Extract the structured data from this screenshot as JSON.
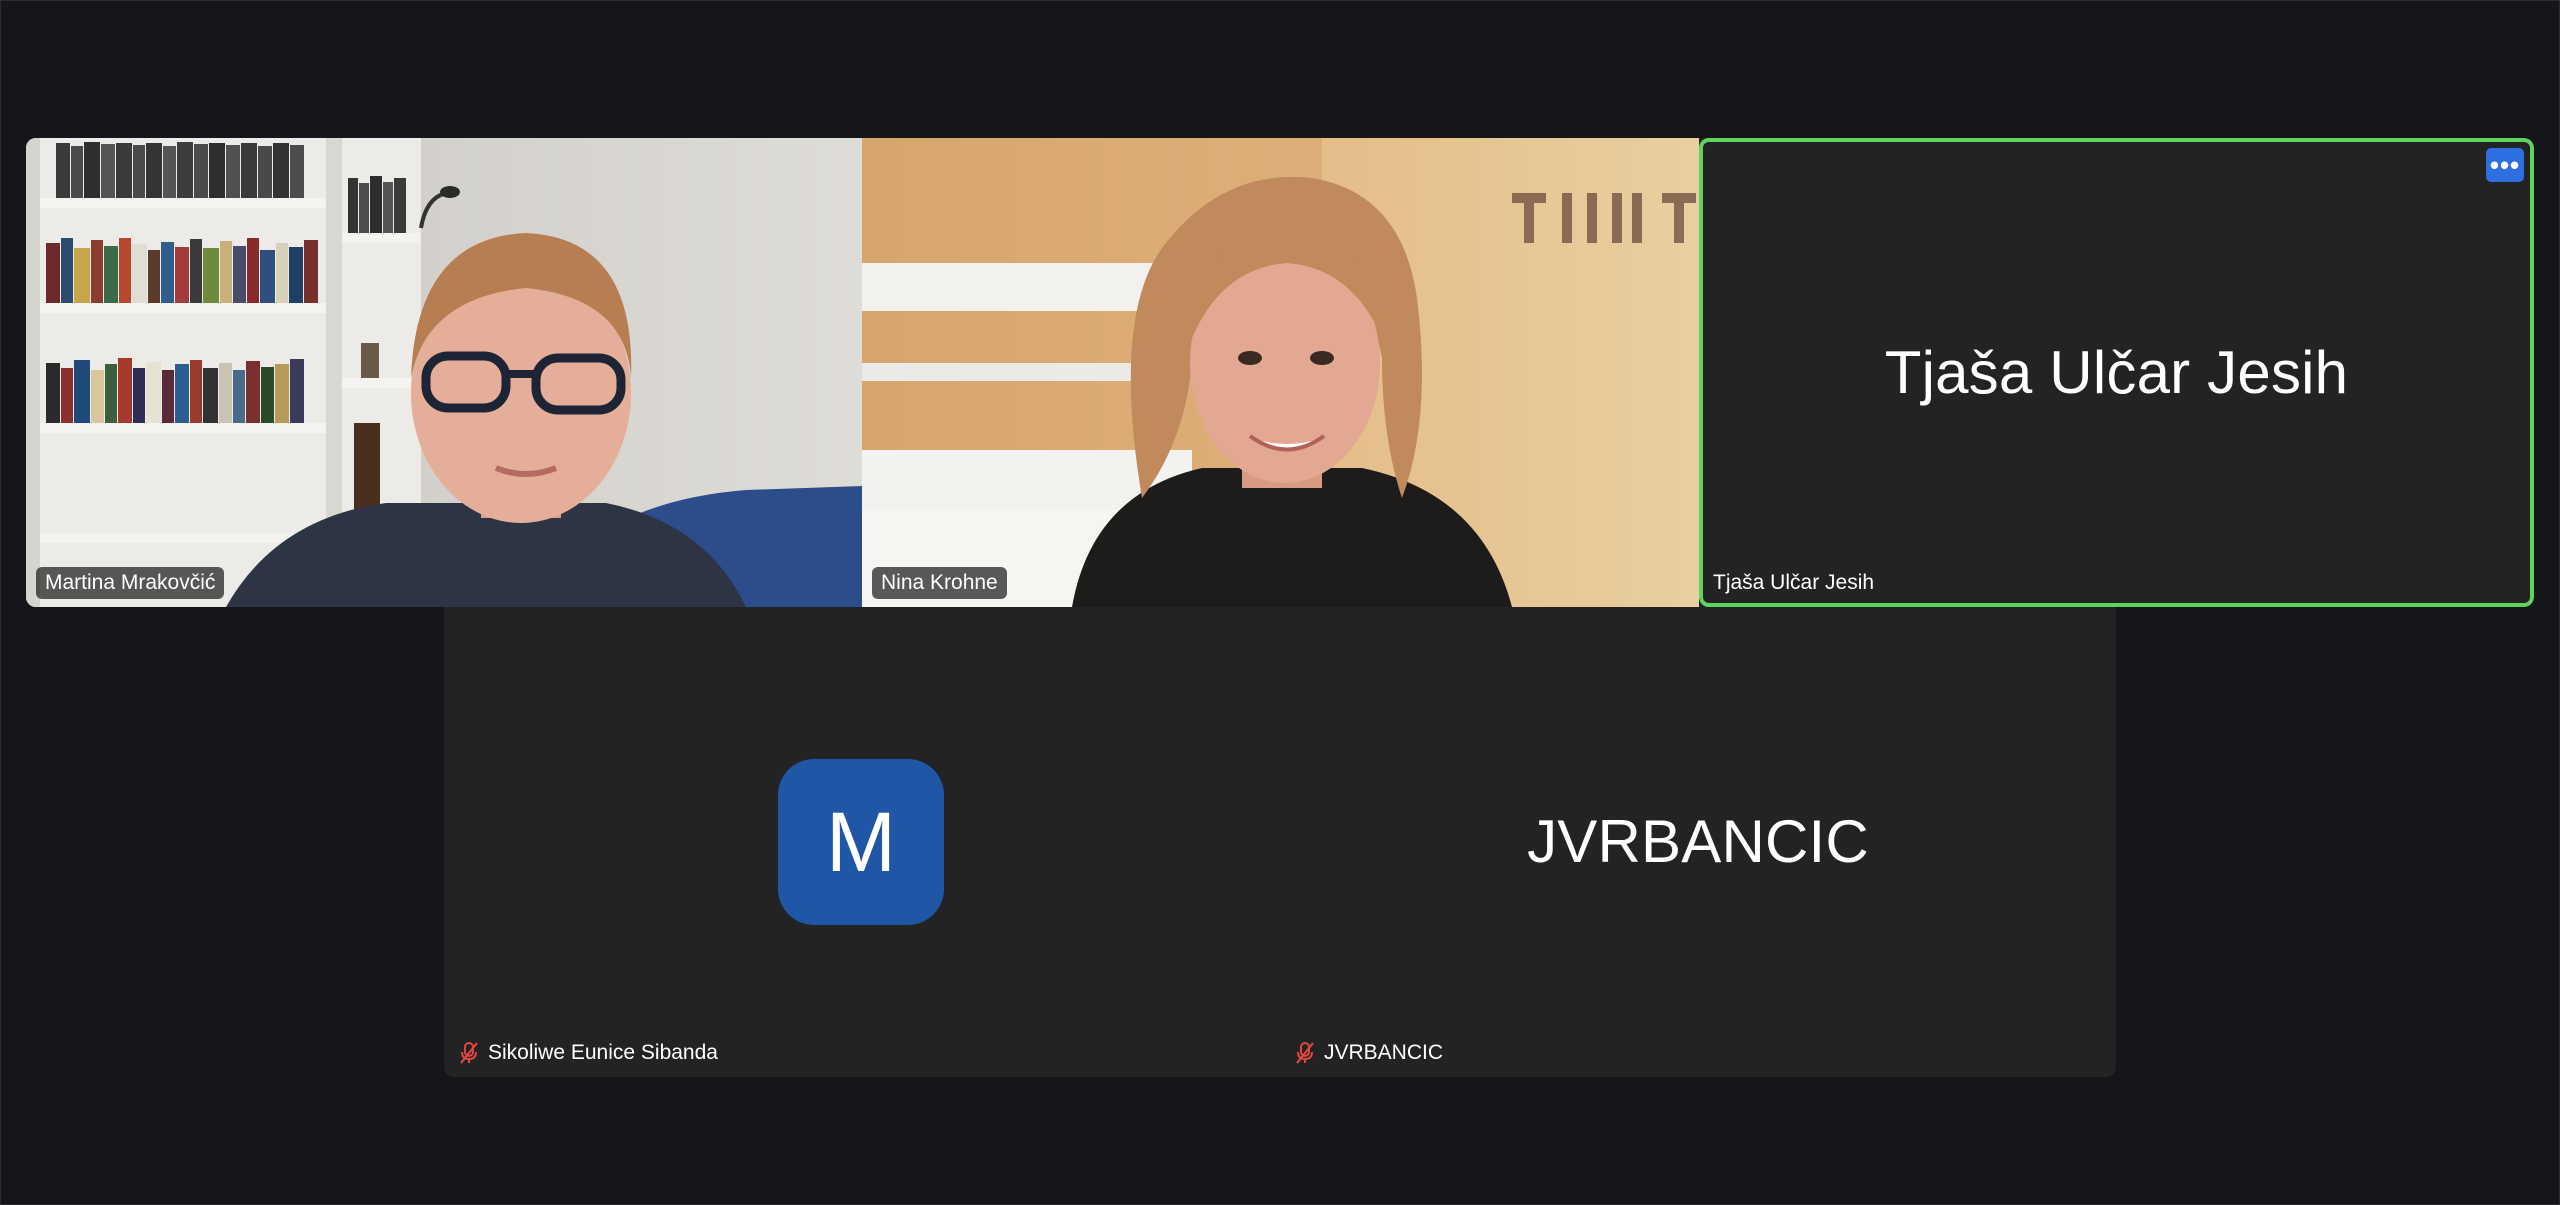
{
  "participants": [
    {
      "name": "Martina Mrakovčić",
      "kind": "video"
    },
    {
      "name": "Nina Krohne",
      "kind": "video"
    },
    {
      "name": "Tjaša Ulčar Jesih",
      "kind": "name-only",
      "active_speaker": true,
      "more_label": "•••"
    },
    {
      "name": "Sikoliwe Eunice Sibanda",
      "kind": "avatar",
      "avatar_initial": "M",
      "muted": true
    },
    {
      "name": "JVRBANCIC",
      "kind": "name-only",
      "muted": true
    }
  ],
  "colors": {
    "background": "#15161a",
    "tile": "#232323",
    "active_border": "#5fd35f",
    "more_button": "#2d6ee0",
    "avatar": "#1f57a6",
    "muted_icon": "#e0463f"
  },
  "icons": {
    "more": "more-options-icon",
    "muted": "microphone-muted-icon"
  }
}
